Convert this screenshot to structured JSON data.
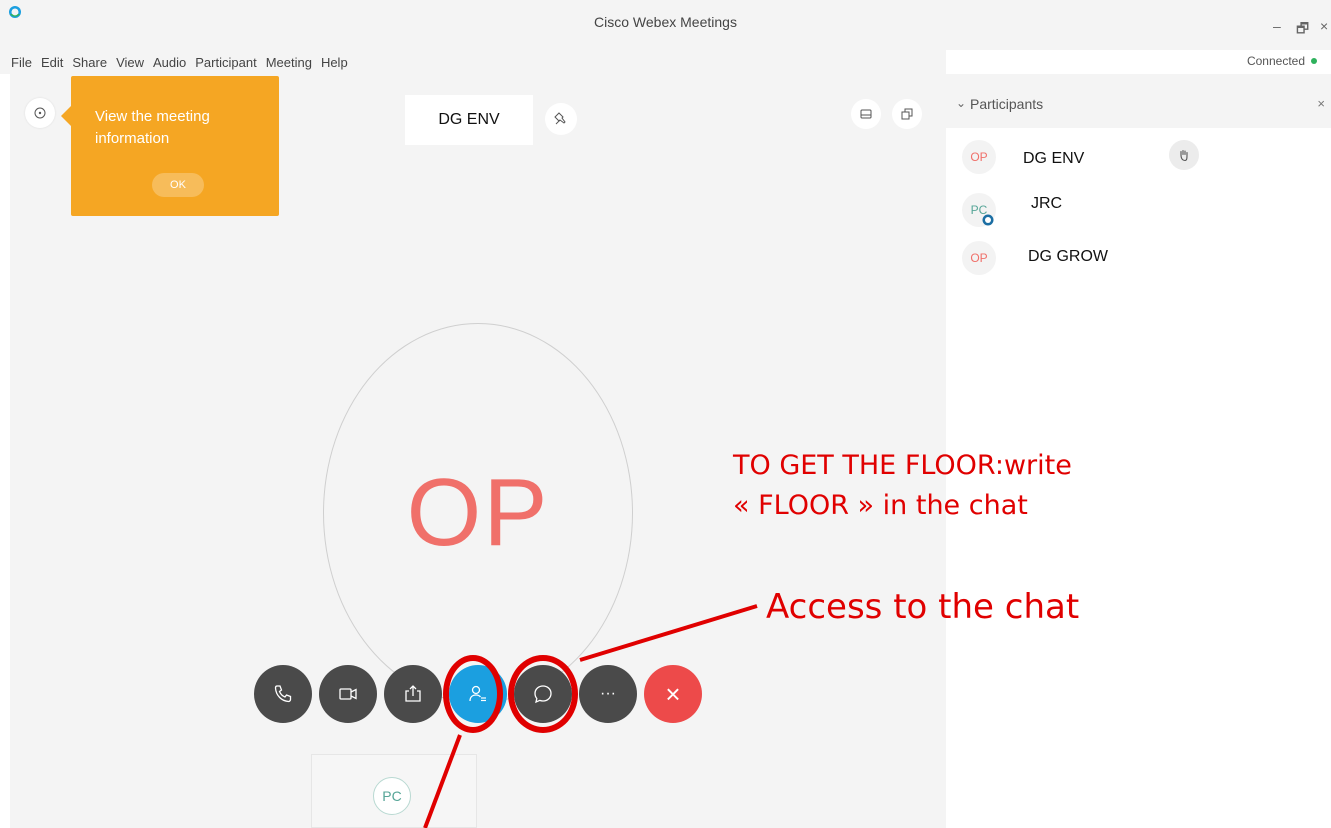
{
  "window": {
    "title": "Cisco Webex Meetings",
    "minimize_glyph": "–",
    "restore_glyph": "🗗",
    "close_glyph": "×"
  },
  "menu": [
    "File",
    "Edit",
    "Share",
    "View",
    "Audio",
    "Participant",
    "Meeting",
    "Help"
  ],
  "status": {
    "text": "Connected",
    "color": "#2eb15c"
  },
  "info_tooltip": {
    "text": "View the meeting information",
    "ok_label": "OK",
    "color": "#f5a623"
  },
  "stage": {
    "active_speaker_label": "DG ENV",
    "active_avatar_initials": "OP",
    "self_avatar_initials": "PC"
  },
  "controls": [
    {
      "name": "audio-button",
      "icon": "phone-icon"
    },
    {
      "name": "video-button",
      "icon": "video-camera-icon"
    },
    {
      "name": "share-button",
      "icon": "share-icon"
    },
    {
      "name": "participants-button",
      "icon": "participants-icon",
      "active": true
    },
    {
      "name": "chat-button",
      "icon": "chat-bubble-icon"
    },
    {
      "name": "more-button",
      "icon": "more-icon",
      "label": "···"
    },
    {
      "name": "leave-button",
      "icon": "close-icon",
      "label": "×"
    }
  ],
  "participants_panel": {
    "title": "Participants",
    "close_glyph": "×",
    "participants": [
      {
        "initials": "OP",
        "name": "DG ENV",
        "initials_color": "#f0706a",
        "hand_raised": true
      },
      {
        "initials": "PC",
        "name": "JRC",
        "initials_color": "#56a597"
      },
      {
        "initials": "OP",
        "name": "DG GROW",
        "initials_color": "#f0706a"
      }
    ]
  },
  "annotations": {
    "floor_line1": "TO GET THE FLOOR:write",
    "floor_line2": "« FLOOR » in the chat",
    "chat": "Access to the chat",
    "color": "#e00000"
  }
}
